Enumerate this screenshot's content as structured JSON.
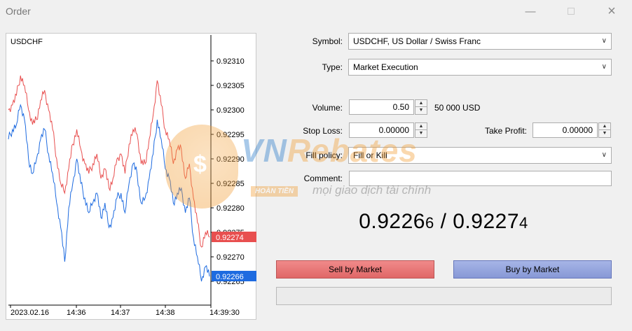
{
  "window": {
    "title": "Order"
  },
  "chart": {
    "symbol": "USDCHF",
    "bid_label": "0.92266",
    "ask_label": "0.92274"
  },
  "chart_data": {
    "type": "line",
    "x_tick_labels": [
      "2023.02.16",
      "14:36",
      "14:37",
      "14:38",
      "14:39:30"
    ],
    "y_tick_labels": [
      "0.92310",
      "0.92305",
      "0.92300",
      "0.92295",
      "0.92290",
      "0.92285",
      "0.92280",
      "0.92275",
      "0.92270",
      "0.92265"
    ],
    "ylim": [
      0.92263,
      0.92312
    ],
    "series": [
      {
        "color": "#e84f4f",
        "values": [
          0.923,
          0.92301,
          0.92303,
          0.92307,
          0.92305,
          0.923,
          0.92297,
          0.92298,
          0.92302,
          0.92304,
          0.923,
          0.92296,
          0.9229,
          0.92285,
          0.92283,
          0.92288,
          0.92293,
          0.92296,
          0.92292,
          0.92289,
          0.92287,
          0.92289,
          0.92291,
          0.92286,
          0.92288,
          0.92284,
          0.92286,
          0.9229,
          0.92291,
          0.92287,
          0.92293,
          0.92296,
          0.92295,
          0.92289,
          0.92289,
          0.92294,
          0.92299,
          0.92306,
          0.92301,
          0.92296,
          0.92294,
          0.92289,
          0.92292,
          0.92292,
          0.92286,
          0.92289,
          0.92282,
          0.92277,
          0.92272,
          0.92275,
          0.92274
        ]
      },
      {
        "color": "#1e6be0",
        "values": [
          0.92294,
          0.92296,
          0.92297,
          0.92301,
          0.92298,
          0.9229,
          0.92287,
          0.9229,
          0.92294,
          0.92296,
          0.92291,
          0.92287,
          0.92281,
          0.92276,
          0.92269,
          0.9228,
          0.92285,
          0.9229,
          0.92285,
          0.92282,
          0.92279,
          0.92281,
          0.92283,
          0.92278,
          0.92281,
          0.92276,
          0.92278,
          0.92282,
          0.92283,
          0.92279,
          0.92285,
          0.92289,
          0.92287,
          0.92281,
          0.92282,
          0.92286,
          0.92291,
          0.92298,
          0.92294,
          0.92288,
          0.92286,
          0.92281,
          0.92283,
          0.92284,
          0.92279,
          0.92282,
          0.92274,
          0.9227,
          0.92265,
          0.92268,
          0.92266
        ]
      }
    ]
  },
  "form": {
    "symbol_label": "Symbol:",
    "symbol_value": "USDCHF, US Dollar / Swiss Franc",
    "type_label": "Type:",
    "type_value": "Market Execution",
    "volume_label": "Volume:",
    "volume_value": "0.50",
    "volume_note": "50 000 USD",
    "stoploss_label": "Stop Loss:",
    "stoploss_value": "0.00000",
    "takeprofit_label": "Take Profit:",
    "takeprofit_value": "0.00000",
    "fillpolicy_label": "Fill policy:",
    "fillpolicy_value": "Fill or Kill",
    "comment_label": "Comment:"
  },
  "quote": {
    "bid_main": "0.9226",
    "bid_small": "6",
    "separator": " / ",
    "ask_main": "0.9227",
    "ask_small": "4"
  },
  "buttons": {
    "sell": "Sell by Market",
    "buy": "Buy by Market"
  },
  "watermark": {
    "brand": "VNRebates",
    "tag": "HOÀN TIỀN",
    "slogan": "mọi giao dịch tài chính"
  },
  "colors": {
    "bid": "#1e6be0",
    "ask": "#e84f4f"
  }
}
